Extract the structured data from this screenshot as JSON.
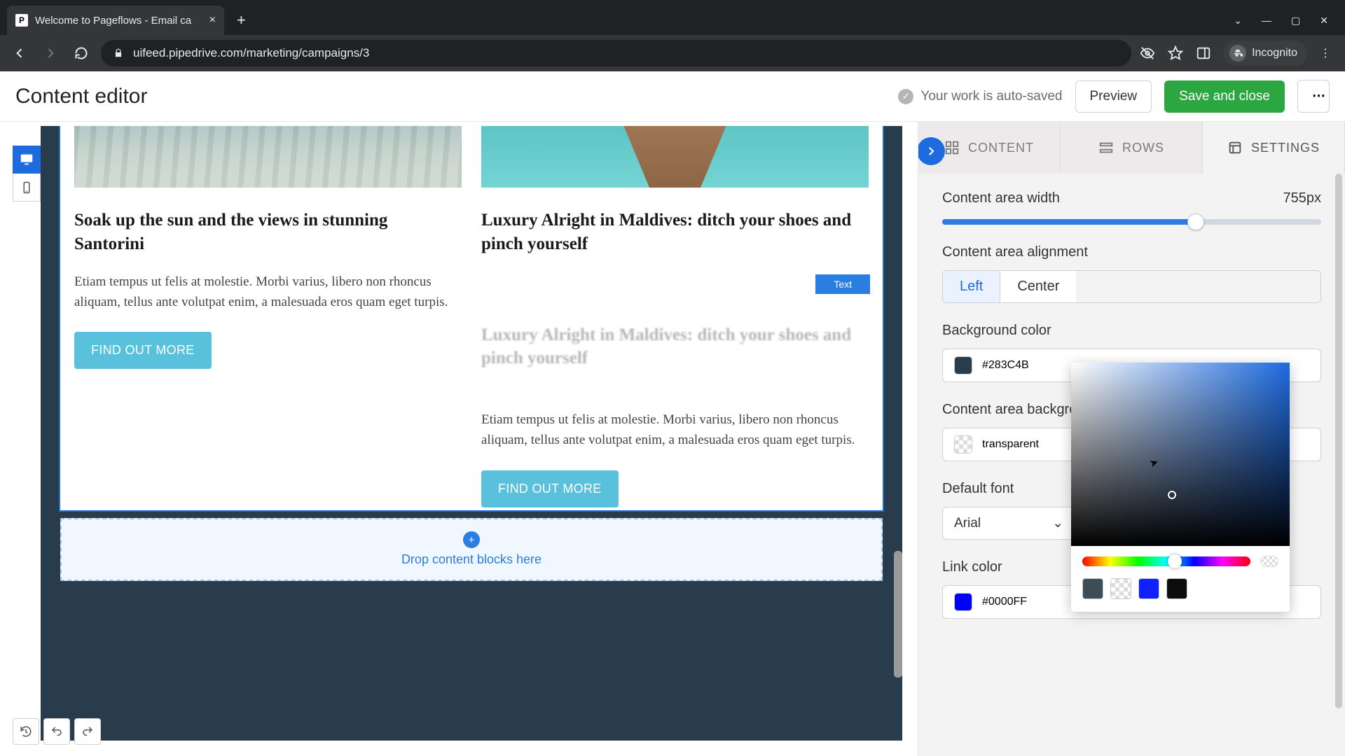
{
  "browser": {
    "tab_title": "Welcome to Pageflows - Email ca",
    "url": "uifeed.pipedrive.com/marketing/campaigns/3",
    "incognito_label": "Incognito"
  },
  "header": {
    "title": "Content editor",
    "autosave": "Your work is auto-saved",
    "preview": "Preview",
    "save": "Save and close"
  },
  "canvas": {
    "col1": {
      "title": "Soak up the sun and the views in stunning Santorini",
      "body": "Etiam tempus ut felis at molestie. Morbi varius, libero non rhoncus aliquam, tellus ante volutpat enim, a malesuada eros quam eget turpis.",
      "cta": "FIND OUT MORE"
    },
    "col2": {
      "title": "Luxury Alright in Maldives: ditch your shoes and pinch yourself",
      "ghost": "Luxury Alright in Maldives: ditch your shoes and pinch yourself",
      "body": "Etiam tempus ut felis at molestie. Morbi varius, libero non rhoncus aliquam, tellus ante volutpat enim, a malesuada eros quam eget turpis.",
      "cta": "FIND OUT MORE",
      "badge": "Text"
    },
    "drop": "Drop content blocks here"
  },
  "panel": {
    "tabs": {
      "content": "CONTENT",
      "rows": "ROWS",
      "settings": "SETTINGS"
    },
    "width_label": "Content area width",
    "width_value": "755px",
    "align_label": "Content area alignment",
    "align_left": "Left",
    "align_center": "Center",
    "bg_label": "Background color",
    "bg_value": "#283C4B",
    "area_bg_label": "Content area background color",
    "area_bg_value": "transparent",
    "font_label": "Default font",
    "font_value": "Arial",
    "link_label": "Link color",
    "link_value": "#0000FF"
  },
  "picker": {
    "presets": [
      "#3d4d57",
      "#e9e9e9",
      "#1020ff",
      "#0d0d0d"
    ]
  }
}
